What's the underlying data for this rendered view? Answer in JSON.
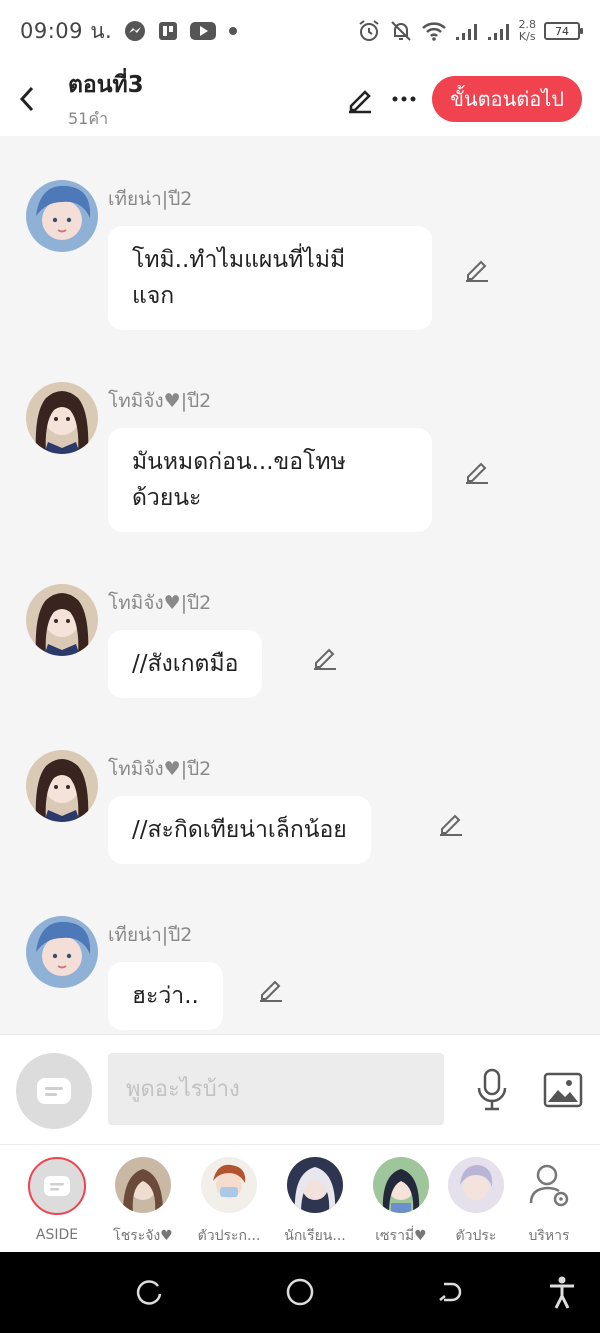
{
  "status_bar": {
    "time": "09:09 น.",
    "network_speed_value": "2.8",
    "network_speed_unit": "K/s",
    "battery": "74",
    "left_icons": [
      "messenger-icon",
      "app-icon",
      "youtube-icon",
      "dot-icon"
    ],
    "right_icons": [
      "alarm-icon",
      "mute-icon",
      "wifi-icon",
      "signal-icon",
      "signal-icon"
    ]
  },
  "header": {
    "title": "ตอนที่3",
    "word_count": "51คำ",
    "next_button": "ขั้นตอนต่อไป",
    "accent_color": "#f0424f"
  },
  "messages": [
    {
      "sender": "เทียน่า|ปี2",
      "text": "โทมิ..ทำไมแผนที่ไม่มี\nแจก",
      "avatar": "tiana"
    },
    {
      "sender": "โทมิจัง♥|ปี2",
      "text": "มันหมดก่อน...ขอโทษ\nด้วยนะ",
      "avatar": "tomi"
    },
    {
      "sender": "โทมิจัง♥|ปี2",
      "text": "//สังเกตมือ",
      "avatar": "tomi"
    },
    {
      "sender": "โทมิจัง♥|ปี2",
      "text": "//สะกิดเทียน่าเล็กน้อย",
      "avatar": "tomi"
    },
    {
      "sender": "เทียน่า|ปี2",
      "text": "ฮะว่า..",
      "avatar": "tiana"
    }
  ],
  "input_bar": {
    "placeholder": "พูดอะไรบ้าง",
    "value": ""
  },
  "characters": [
    {
      "name": "ASIDE"
    },
    {
      "name": "โชระจัง♥"
    },
    {
      "name": "ตัวประก..."
    },
    {
      "name": "นักเรียน..."
    },
    {
      "name": "เซรามี่♥"
    },
    {
      "name": "ตัวประ"
    },
    {
      "name": "บริหาร"
    }
  ],
  "nav_icons": [
    "recent-apps-icon",
    "home-icon",
    "back-icon",
    "accessibility-icon"
  ]
}
